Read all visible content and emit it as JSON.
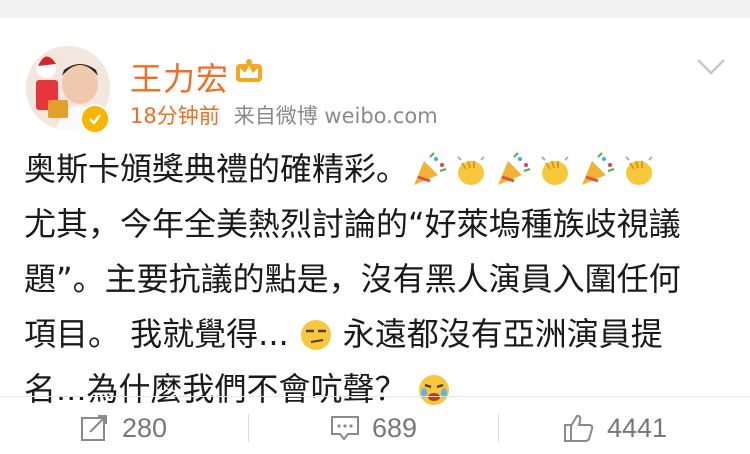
{
  "post": {
    "author": "王力宏",
    "time": "18分钟前",
    "source": "来自微博 weibo.com",
    "lines": [
      "奥斯卡頒獎典禮的確精彩。",
      "尤其，今年全美熱烈討論的“好萊塢種族歧視議",
      "題”。主要抗議的點是，沒有黑人演員入圍任何",
      "項目。 我就覺得...",
      "永遠都沒有亞洲演員提",
      "名...為什麼我們不會吭聲？"
    ]
  },
  "actions": {
    "repost_count": "280",
    "comment_count": "689",
    "like_count": "4441"
  },
  "colors": {
    "name": "#f26d22",
    "meta": "#8a8a8a",
    "verified": "#f7b500",
    "text": "#1a1a1a"
  },
  "icons": [
    "crown-icon",
    "verified-icon",
    "chevron-down-icon",
    "party-popper-icon",
    "clapping-hands-icon",
    "smirk-face-icon",
    "crying-face-icon",
    "repost-icon",
    "comment-icon",
    "like-icon"
  ]
}
